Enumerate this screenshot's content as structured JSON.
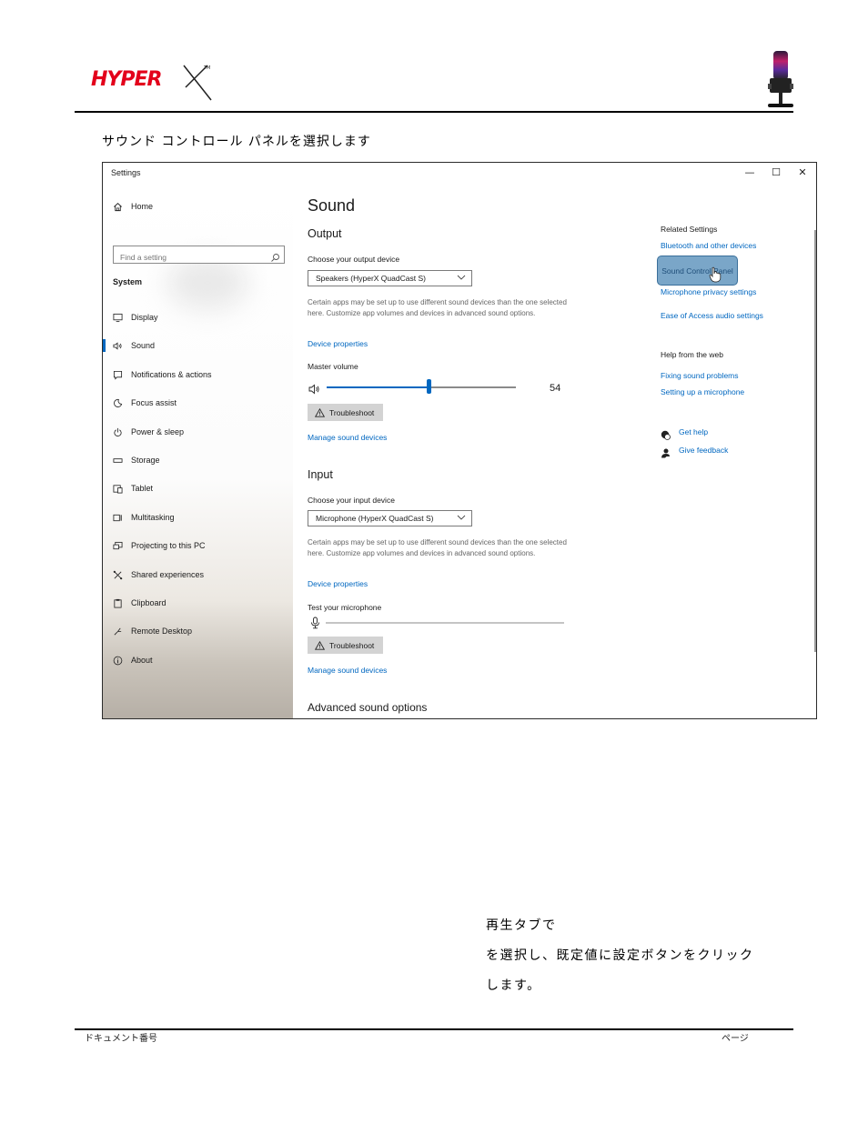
{
  "header": {
    "logo_text": "HYPERX",
    "instruction": "サウンド コントロール パネルを選択します"
  },
  "window": {
    "title": "Settings",
    "controls": {
      "minimize": "—",
      "maximize": "☐",
      "close": "✕"
    },
    "sidebar": {
      "home_label": "Home",
      "search_placeholder": "Find a setting",
      "section": "System",
      "items": [
        {
          "label": "Display",
          "icon": "monitor-icon"
        },
        {
          "label": "Sound",
          "icon": "speaker-icon",
          "active": true
        },
        {
          "label": "Notifications & actions",
          "icon": "notification-icon"
        },
        {
          "label": "Focus assist",
          "icon": "moon-icon"
        },
        {
          "label": "Power & sleep",
          "icon": "power-icon"
        },
        {
          "label": "Storage",
          "icon": "storage-icon"
        },
        {
          "label": "Tablet",
          "icon": "tablet-icon"
        },
        {
          "label": "Multitasking",
          "icon": "multitasking-icon"
        },
        {
          "label": "Projecting to this PC",
          "icon": "projecting-icon"
        },
        {
          "label": "Shared experiences",
          "icon": "shared-icon"
        },
        {
          "label": "Clipboard",
          "icon": "clipboard-icon"
        },
        {
          "label": "Remote Desktop",
          "icon": "remote-desktop-icon"
        },
        {
          "label": "About",
          "icon": "info-icon"
        }
      ]
    },
    "main": {
      "title": "Sound",
      "output": {
        "heading": "Output",
        "choose_label": "Choose your output device",
        "device": "Speakers (HyperX QuadCast S)",
        "description": "Certain apps may be set up to use different sound devices than the one selected here. Customize app volumes and devices in advanced sound options.",
        "device_properties": "Device properties",
        "master_volume_label": "Master volume",
        "volume": 54,
        "troubleshoot": "Troubleshoot",
        "manage": "Manage sound devices"
      },
      "input": {
        "heading": "Input",
        "choose_label": "Choose your input device",
        "device": "Microphone (HyperX QuadCast S)",
        "description": "Certain apps may be set up to use different sound devices than the one selected here. Customize app volumes and devices in advanced sound options.",
        "device_properties": "Device properties",
        "test_label": "Test your microphone",
        "troubleshoot": "Troubleshoot",
        "manage": "Manage sound devices"
      },
      "advanced": "Advanced sound options"
    },
    "related": {
      "heading": "Related Settings",
      "links": [
        "Bluetooth and other devices",
        "Sound Control Panel",
        "Microphone privacy settings",
        "Ease of Access audio settings"
      ],
      "help_heading": "Help from the web",
      "help_links": [
        "Fixing sound problems",
        "Setting up a microphone"
      ],
      "get_help": "Get help",
      "give_feedback": "Give feedback"
    }
  },
  "body": {
    "line1": "再生タブで",
    "line2": "を選択し、既定値に設定ボタンをクリック",
    "line3": "します。"
  },
  "footer": {
    "doc_number": "ドキュメント番号",
    "page": "ページ"
  },
  "colors": {
    "accent": "#0067c0",
    "brand_red": "#e3001b",
    "highlight": "#7aa6c8"
  }
}
